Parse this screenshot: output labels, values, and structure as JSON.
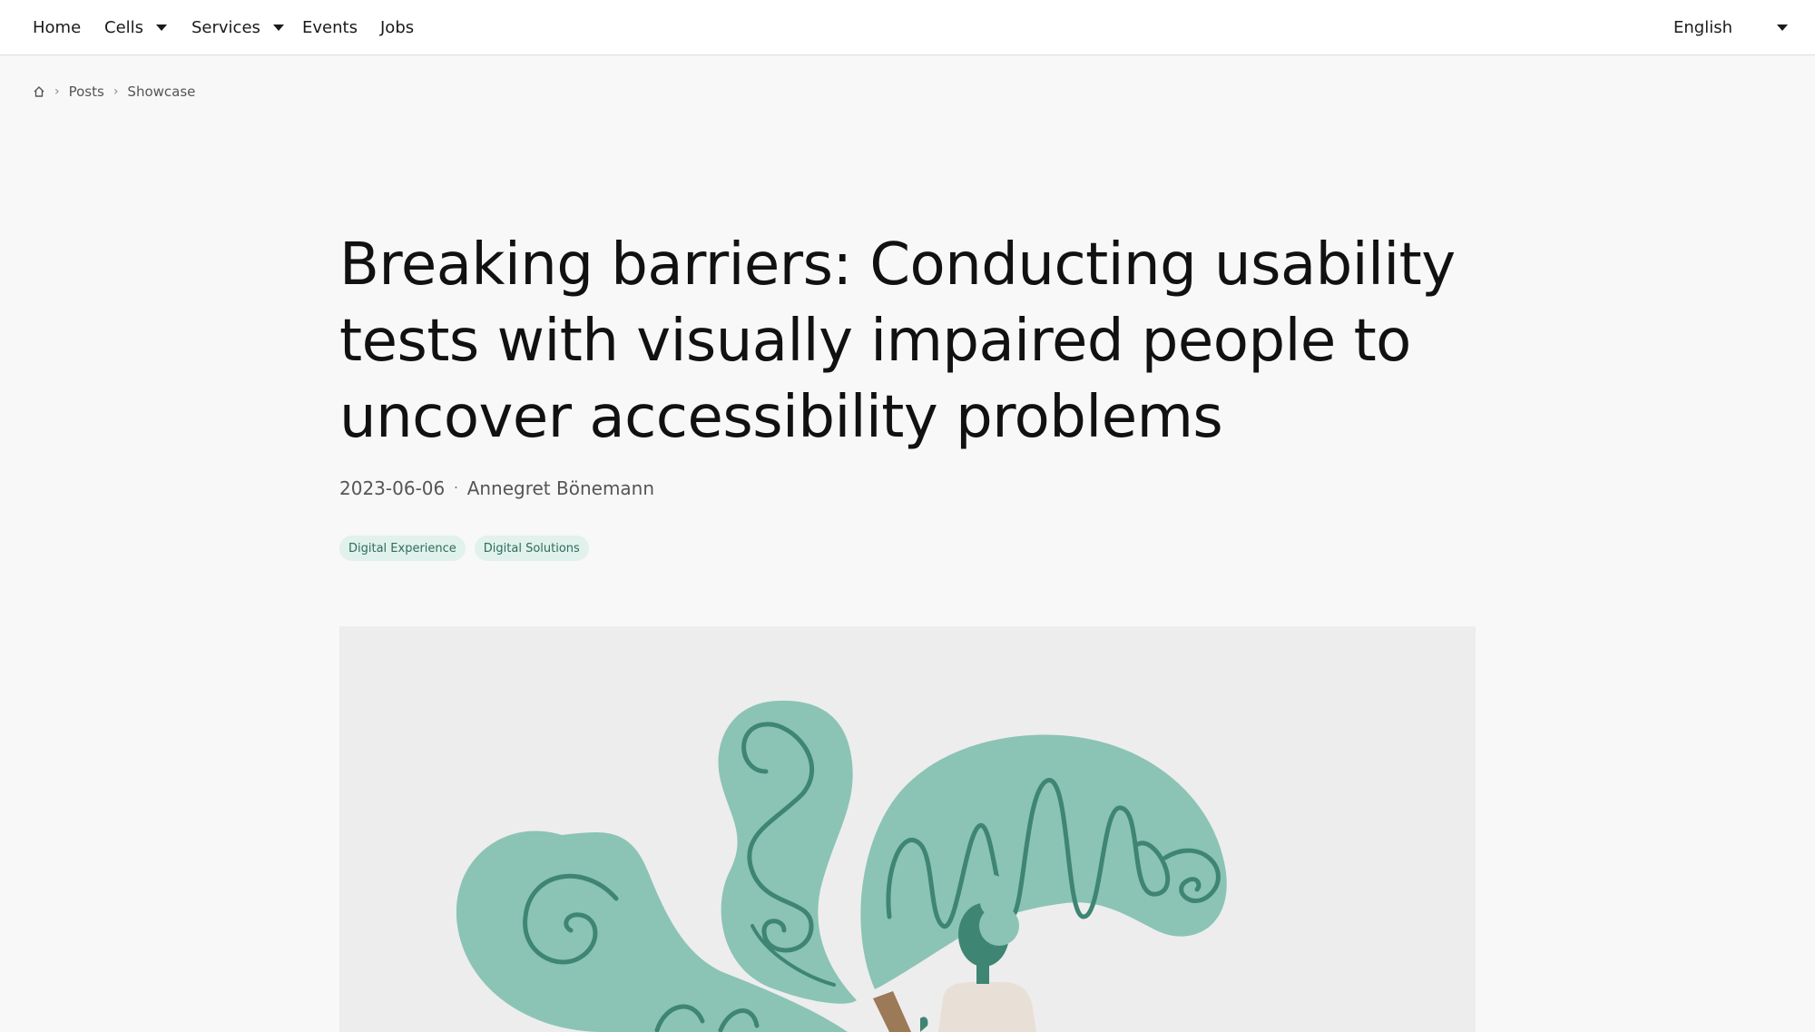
{
  "nav": {
    "items": [
      {
        "label": "Home",
        "dropdown": false
      },
      {
        "label": "Cells",
        "dropdown": true
      },
      {
        "label": "Services",
        "dropdown": true
      },
      {
        "label": "Events",
        "dropdown": false
      },
      {
        "label": "Jobs",
        "dropdown": false
      }
    ],
    "language": "English"
  },
  "breadcrumb": {
    "home_icon": "home-icon",
    "items": [
      "Posts",
      "Showcase"
    ]
  },
  "article": {
    "title": "Breaking barriers: Conducting usability tests with visually impaired people to un­cover accessibility problems",
    "date": "2023-06-06",
    "separator": "·",
    "author": "Annegret Bönemann",
    "tags": [
      "Digital Experience",
      "Digital Solutions"
    ]
  },
  "colors": {
    "tag_bg": "#e1f1ec",
    "tag_text": "#2d6d5c",
    "illustration_green": "#8bc4b4",
    "illustration_dark": "#3f8573",
    "hero_bg": "#ededed"
  }
}
